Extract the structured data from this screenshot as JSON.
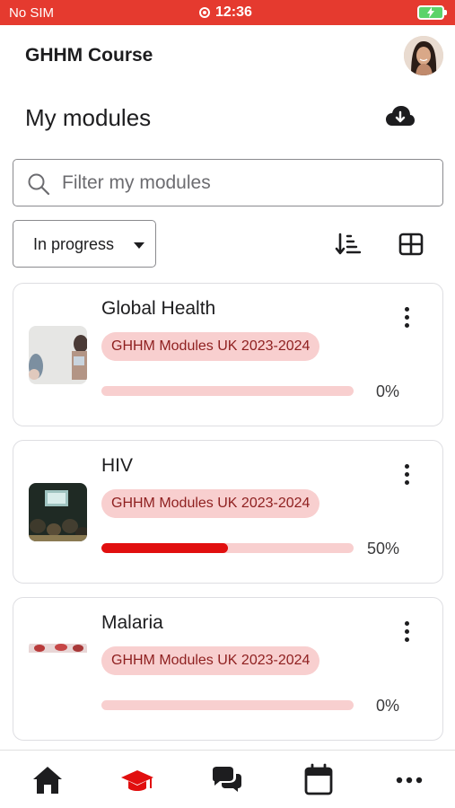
{
  "status_bar": {
    "carrier": "No SIM",
    "time": "12:36"
  },
  "header": {
    "course_title": "GHHM Course"
  },
  "page": {
    "title": "My modules"
  },
  "search": {
    "placeholder": "Filter my modules",
    "value": ""
  },
  "filter": {
    "selected": "In progress"
  },
  "modules": [
    {
      "title": "Global Health",
      "tag": "GHHM Modules UK 2023-2024",
      "progress": 0,
      "progress_label": "0%"
    },
    {
      "title": "HIV",
      "tag": "GHHM Modules UK 2023-2024",
      "progress": 50,
      "progress_label": "50%"
    },
    {
      "title": "Malaria",
      "tag": "GHHM Modules UK 2023-2024",
      "progress": 0,
      "progress_label": "0%"
    }
  ],
  "icons": {
    "download": "cloud-download-icon",
    "search": "search-icon",
    "sort": "sort-icon",
    "grid": "grid-view-icon",
    "more": "more-vertical-icon",
    "tabs": [
      "home-icon",
      "graduation-cap-icon",
      "chat-icon",
      "calendar-icon",
      "more-horizontal-icon"
    ]
  },
  "colors": {
    "accent": "#e53a2f",
    "progress_fill": "#e10f0f",
    "tag_bg": "#f8cfcf",
    "tag_text": "#8e1f1f"
  }
}
